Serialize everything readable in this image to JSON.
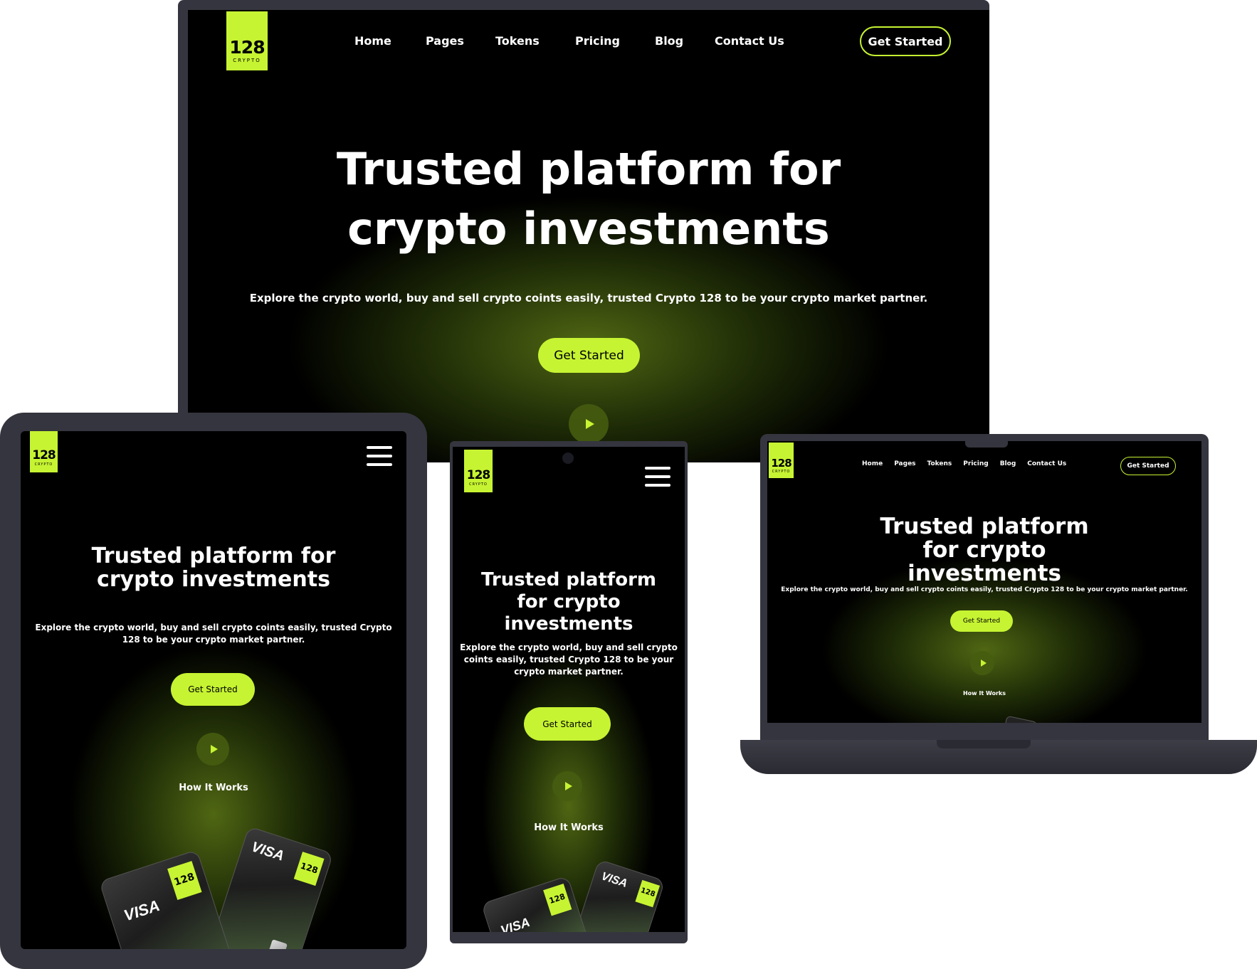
{
  "brand": {
    "number": "128",
    "tagline": "CRYPTO"
  },
  "nav": [
    "Home",
    "Pages",
    "Tokens",
    "Pricing",
    "Blog",
    "Contact Us"
  ],
  "header_cta": "Get Started",
  "hero": {
    "title": "Trusted platform for crypto investments",
    "subtitle": "Explore the crypto world, buy and sell crypto coints easily, trusted Crypto 128 to be your crypto market partner.",
    "cta": "Get Started",
    "how_it_works": "How It Works"
  },
  "card_brand": "VISA",
  "colors": {
    "accent": "#c6f432",
    "background": "#000000",
    "device_frame": "#35353f"
  }
}
